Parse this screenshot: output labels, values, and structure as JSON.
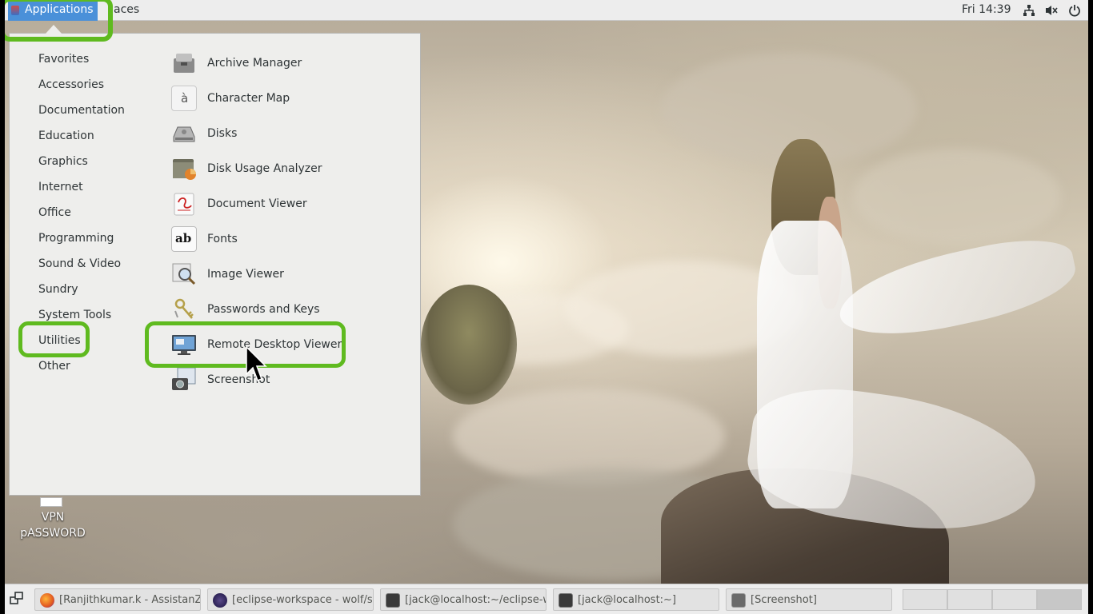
{
  "topbar": {
    "applications_label": "Applications",
    "places_label": "aces",
    "clock": "Fri 14:39",
    "network_icon": "network-icon",
    "volume_icon": "volume-muted-icon",
    "power_icon": "power-icon"
  },
  "menu": {
    "categories": [
      "Favorites",
      "Accessories",
      "Documentation",
      "Education",
      "Graphics",
      "Internet",
      "Office",
      "Programming",
      "Sound & Video",
      "Sundry",
      "System Tools",
      "Utilities",
      "Other"
    ],
    "selected_category": "Utilities",
    "apps": [
      {
        "label": "Archive Manager",
        "icon": "archive-manager-icon"
      },
      {
        "label": "Character Map",
        "icon": "character-map-icon"
      },
      {
        "label": "Disks",
        "icon": "disks-icon"
      },
      {
        "label": "Disk Usage Analyzer",
        "icon": "disk-usage-analyzer-icon"
      },
      {
        "label": "Document Viewer",
        "icon": "document-viewer-icon"
      },
      {
        "label": "Fonts",
        "icon": "fonts-icon"
      },
      {
        "label": "Image Viewer",
        "icon": "image-viewer-icon"
      },
      {
        "label": "Passwords and Keys",
        "icon": "passwords-keys-icon"
      },
      {
        "label": "Remote Desktop Viewer",
        "icon": "remote-desktop-icon"
      },
      {
        "label": "Screenshot",
        "icon": "screenshot-icon"
      }
    ],
    "character_map_glyph": "à",
    "fonts_glyph": "ab"
  },
  "desktop": {
    "file_label_line1": "VPN",
    "file_label_line2": "pASSWORD"
  },
  "taskbar": {
    "tasks": [
      {
        "label": "[Ranjithkumar.k - AssistanZ..."
      },
      {
        "label": "[eclipse-workspace - wolf/s..."
      },
      {
        "label": "[jack@localhost:~/eclipse-w..."
      },
      {
        "label": "[jack@localhost:~]"
      },
      {
        "label": "[Screenshot]"
      }
    ],
    "workspaces": 4,
    "active_workspace": 4
  },
  "colors": {
    "highlight": "#5fba1f",
    "applications_button": "#4a90d9",
    "panel": "#ededed",
    "menu_bg": "#eeeeec"
  }
}
